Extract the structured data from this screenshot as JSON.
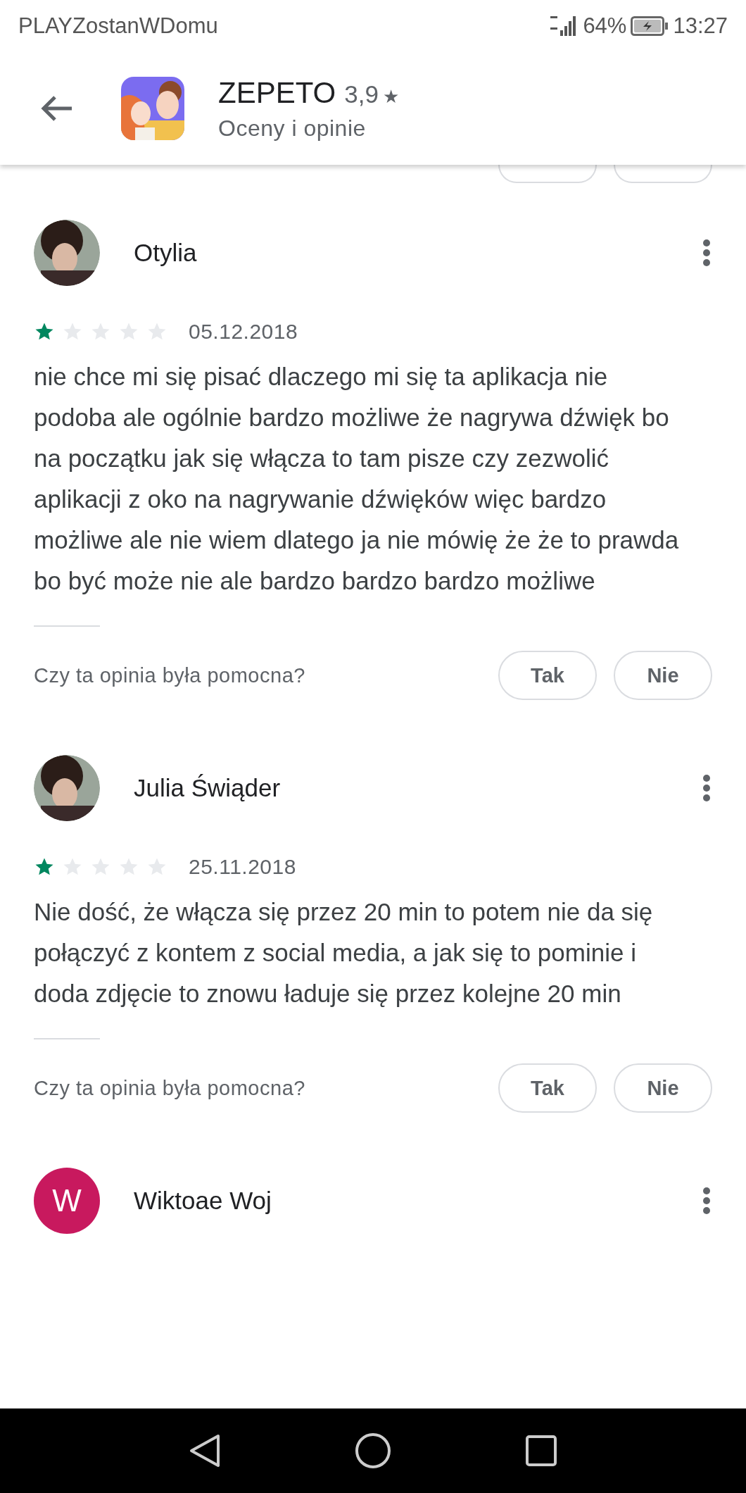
{
  "status_bar": {
    "carrier": "PLAYZostanWDomu",
    "battery": "64%",
    "time": "13:27"
  },
  "header": {
    "app_name": "ZEPETO",
    "rating": "3,9",
    "star": "★",
    "subtitle": "Oceny i opinie"
  },
  "partial_helpful": {
    "kind": "cut_buttons"
  },
  "reviews": [
    {
      "author": "Otylia",
      "stars": 1,
      "date": "05.12.2018",
      "text": "nie chce mi się pisać dlaczego mi się ta aplikacja nie podoba ale ogólnie bardzo możliwe że nagrywa dźwięk bo na początku jak się włącza to tam pisze czy zezwolić aplikacji z oko na nagrywanie dźwięków więc bardzo możliwe ale nie wiem dlatego ja nie mówię że że to prawda bo być może nie ale bardzo bardzo bardzo możliwe",
      "helpful": {
        "question": "Czy ta opinia była pomocna?",
        "yes": "Tak",
        "no": "Nie"
      }
    },
    {
      "author": "Julia Świąder",
      "stars": 1,
      "date": "25.11.2018",
      "text": "Nie dość, że włącza się przez 20 min to potem nie da się połączyć z kontem z social media, a jak się to pominie i doda zdjęcie to znowu ładuje się przez kolejne 20 min",
      "helpful": {
        "question": "Czy ta opinia była pomocna?",
        "yes": "Tak",
        "no": "Nie"
      }
    },
    {
      "author": "Wiktoae Woj",
      "avatar": {
        "kind": "letter",
        "letter": "W",
        "color": "#c8195e"
      }
    }
  ]
}
